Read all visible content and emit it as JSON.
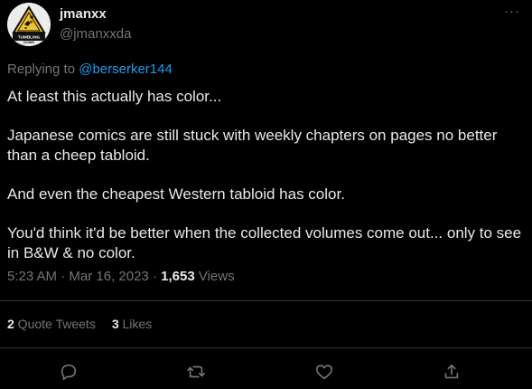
{
  "author": {
    "display_name": "jmanxx",
    "handle": "@jmanxxda",
    "avatar_text": "TUMBLING DOWN"
  },
  "more_label": "···",
  "reply": {
    "prefix": "Replying to ",
    "mention": "@berserker144"
  },
  "tweet": {
    "paragraphs": [
      "At least this actually has color...",
      "Japanese comics are still stuck with weekly chapters on pages no better than a cheep tabloid.",
      "And even the cheapest Western tabloid has color.",
      "You'd think it'd be better when the collected volumes come out... only to see in B&W & no color."
    ]
  },
  "meta": {
    "time": "5:23 AM",
    "sep1": " · ",
    "date": "Mar 16, 2023",
    "sep2": " · ",
    "views_count": "1,653",
    "views_label": " Views"
  },
  "stats": {
    "quote_tweets_count": "2",
    "quote_tweets_label": " Quote Tweets",
    "likes_count": "3",
    "likes_label": " Likes"
  },
  "actions": {
    "reply_icon": "reply-icon",
    "retweet_icon": "retweet-icon",
    "like_icon": "heart-icon",
    "share_icon": "share-icon"
  },
  "colors": {
    "background": "#000000",
    "text": "#e7e9ea",
    "muted": "#71767b",
    "link": "#1d9bf0",
    "divider": "#2f3336"
  }
}
